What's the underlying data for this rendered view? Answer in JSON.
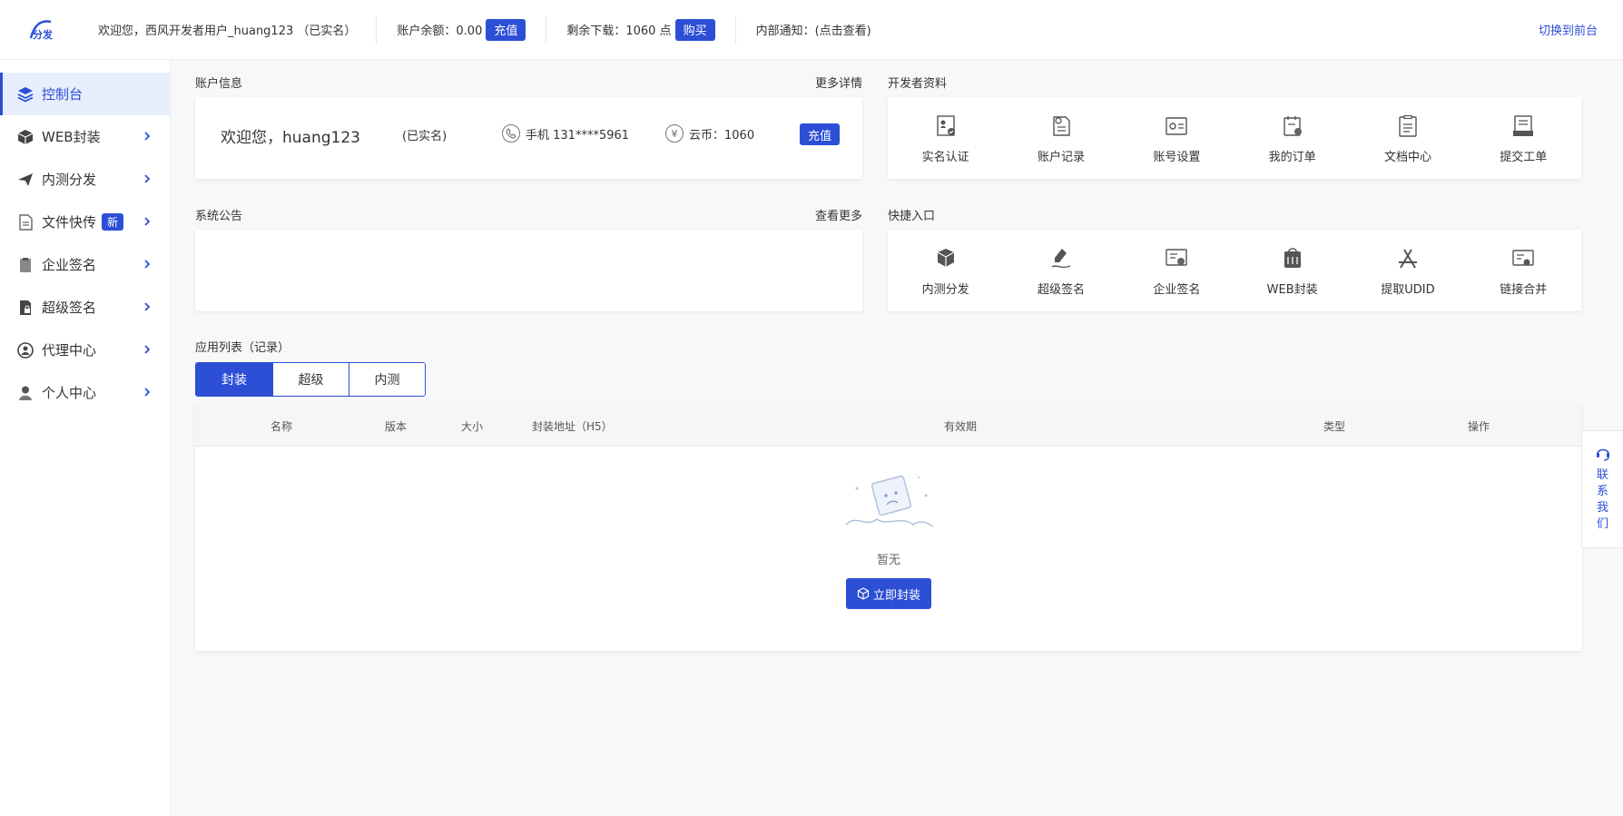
{
  "header": {
    "welcome": "欢迎您，西风开发者用户_huang123 （已实名）",
    "balance_label": "账户余额：0.00",
    "recharge_label": "充值",
    "downloads_label": "剩余下载：1060 点",
    "buy_label": "购买",
    "notice_label": "内部通知：(点击查看)",
    "switch_label": "切换到前台"
  },
  "sidebar": {
    "items": [
      {
        "label": "控制台",
        "icon": "layers-icon",
        "active": true
      },
      {
        "label": "WEB封装",
        "icon": "box-icon"
      },
      {
        "label": "内测分发",
        "icon": "paper-plane-icon"
      },
      {
        "label": "文件快传",
        "icon": "file-icon",
        "badge": "新"
      },
      {
        "label": "企业签名",
        "icon": "clipboard-icon"
      },
      {
        "label": "超级签名",
        "icon": "document-lock-icon"
      },
      {
        "label": "代理中心",
        "icon": "agent-icon"
      },
      {
        "label": "个人中心",
        "icon": "user-icon"
      }
    ]
  },
  "account": {
    "title": "账户信息",
    "more": "更多详情",
    "welcome": "欢迎您，huang123",
    "verified": "(已实名)",
    "phone": "手机 131****5961",
    "coin": "云币：1060",
    "recharge": "充值"
  },
  "developer": {
    "title": "开发者资料",
    "items": [
      {
        "label": "实名认证",
        "icon": "id-verify-icon"
      },
      {
        "label": "账户记录",
        "icon": "record-icon"
      },
      {
        "label": "账号设置",
        "icon": "settings-card-icon"
      },
      {
        "label": "我的订单",
        "icon": "order-icon"
      },
      {
        "label": "文档中心",
        "icon": "document-icon"
      },
      {
        "label": "提交工单",
        "icon": "ticket-icon"
      }
    ]
  },
  "notice": {
    "title": "系统公告",
    "more": "查看更多"
  },
  "quick": {
    "title": "快捷入口",
    "items": [
      {
        "label": "内测分发",
        "icon": "cubes-icon"
      },
      {
        "label": "超级签名",
        "icon": "pen-sign-icon"
      },
      {
        "label": "企业签名",
        "icon": "certificate-icon"
      },
      {
        "label": "WEB封装",
        "icon": "package-icon"
      },
      {
        "label": "提取UDID",
        "icon": "app-store-icon"
      },
      {
        "label": "链接合并",
        "icon": "link-merge-icon"
      }
    ]
  },
  "apps": {
    "title": "应用列表（记录）",
    "tabs": [
      {
        "label": "封装",
        "active": true
      },
      {
        "label": "超级"
      },
      {
        "label": "内测"
      }
    ],
    "columns": [
      "名称",
      "版本",
      "大小",
      "封装地址（H5）",
      "有效期",
      "类型",
      "操作"
    ],
    "empty_text": "暂无",
    "pack_button": "立即封装"
  },
  "contact": {
    "label": "联系我们"
  },
  "colors": {
    "accent": "#2c4fd6",
    "active_bg": "#e7eefc",
    "page_bg": "#f7f8fa"
  }
}
